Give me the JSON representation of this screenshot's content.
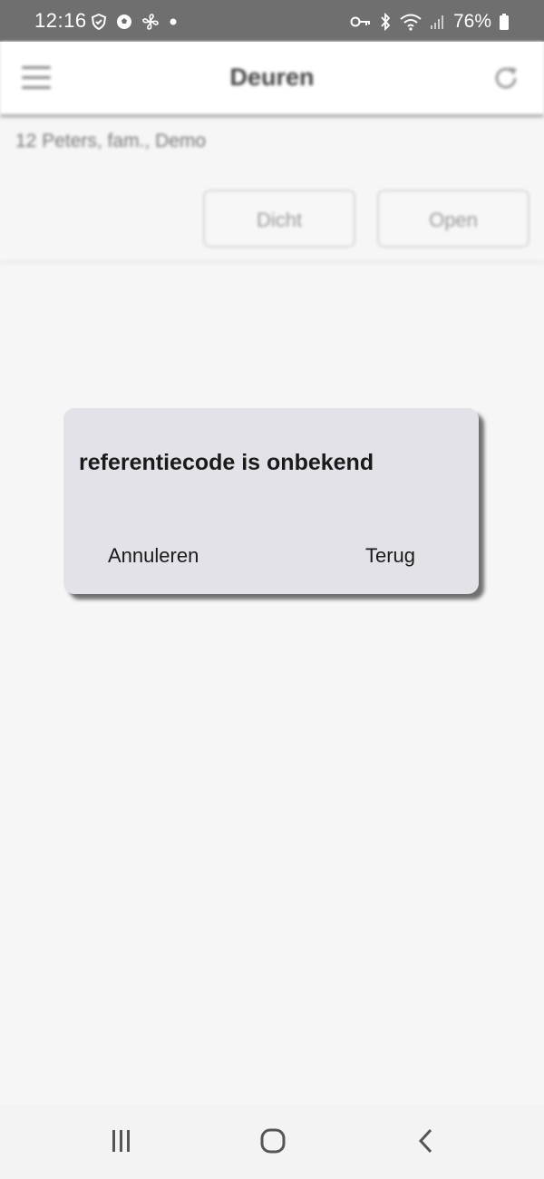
{
  "status_bar": {
    "time": "12:16",
    "battery_percent": "76%",
    "left_icons": [
      "shield-icon",
      "soccer-ball-icon",
      "fan-icon",
      "dot-icon"
    ],
    "right_icons": [
      "key-icon",
      "bluetooth-icon",
      "wifi-icon",
      "signal-icon",
      "battery-icon"
    ],
    "background": "#6f6f6f"
  },
  "app_bar": {
    "title": "Deuren",
    "menu_icon": "hamburger-menu-icon",
    "refresh_icon": "refresh-icon"
  },
  "location": {
    "address": "12 Peters, fam., Demo"
  },
  "door_actions": {
    "close_label": "Dicht",
    "open_label": "Open"
  },
  "dialog": {
    "message": "referentiecode is onbekend",
    "cancel_label": "Annuleren",
    "back_label": "Terug",
    "background": "#e3e2e8"
  },
  "nav_bar": {
    "icons": [
      "recent-apps-icon",
      "home-icon",
      "back-icon"
    ]
  }
}
